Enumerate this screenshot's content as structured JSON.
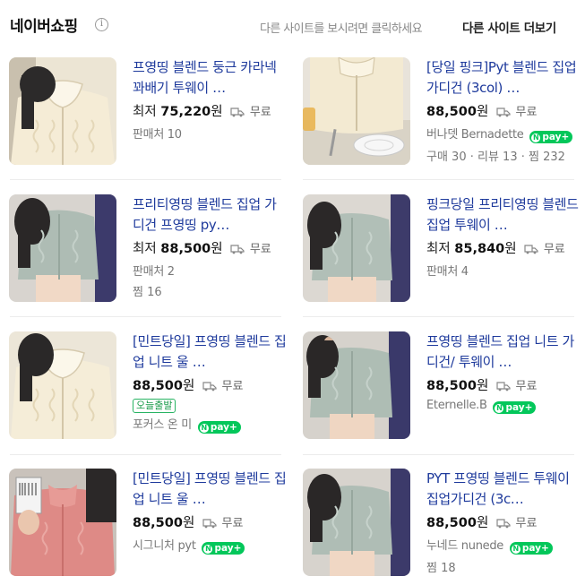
{
  "header": {
    "brand": "네이버쇼핑",
    "info_symbol": "i",
    "hint": "다른 사이트를 보시려면 클릭하세요",
    "more_link": "다른 사이트 더보기"
  },
  "icons": {
    "shipping": "truck-icon",
    "npay": "npay-badge-icon",
    "info": "info-icon"
  },
  "colors": {
    "title": "#1e3a9c",
    "npay": "#03c75a",
    "badge": "#28b463"
  },
  "products": [
    {
      "title": "프영띵 블렌드 둥근 카라넥 꽈배기 투웨이 …",
      "price_prefix": "최저",
      "price": "75,220",
      "currency": "원",
      "shipping": "무료",
      "meta": "판매처 10"
    },
    {
      "title": "[당일 핑크]Pyt 블렌드 집업 가디건 (3col) …",
      "price": "88,500",
      "currency": "원",
      "shipping": "무료",
      "seller": "버나뎃 Bernadette",
      "npay_label": "pay",
      "npay_n": "N",
      "npay_plus": "+",
      "meta": "구매 30 · 리뷰 13 · 찜 232"
    },
    {
      "title": "프리티영띵 블렌드 집업 가디건 프영띵 py…",
      "price_prefix": "최저",
      "price": "88,500",
      "currency": "원",
      "shipping": "무료",
      "meta": "판매처 2",
      "meta2": "찜 16"
    },
    {
      "title": "핑크당일 프리티영띵 블렌드 집업 투웨이 …",
      "price_prefix": "최저",
      "price": "85,840",
      "currency": "원",
      "shipping": "무료",
      "meta": "판매처 4"
    },
    {
      "title": "[민트당일] 프영띵 블렌드 집업 니트 울 …",
      "price": "88,500",
      "currency": "원",
      "shipping": "무료",
      "badge": "오늘출발",
      "seller": "포커스 온 미",
      "npay_label": "pay",
      "npay_n": "N",
      "npay_plus": "+"
    },
    {
      "title": "프영띵 블렌드 집업 니트 가디건/ 투웨이 …",
      "price": "88,500",
      "currency": "원",
      "shipping": "무료",
      "seller": "Eternelle.B",
      "npay_label": "pay",
      "npay_n": "N",
      "npay_plus": "+"
    },
    {
      "title": "[민트당일] 프영띵 블렌드 집업 니트 울 …",
      "price": "88,500",
      "currency": "원",
      "shipping": "무료",
      "seller": "시그니처 pyt",
      "npay_label": "pay",
      "npay_n": "N",
      "npay_plus": "+"
    },
    {
      "title": "PYT 프영띵 블렌드 투웨이 집업가디건 (3c…",
      "price": "88,500",
      "currency": "원",
      "shipping": "무료",
      "seller": "누네드 nunede",
      "npay_label": "pay",
      "npay_n": "N",
      "npay_plus": "+",
      "meta": "찜 18"
    }
  ]
}
